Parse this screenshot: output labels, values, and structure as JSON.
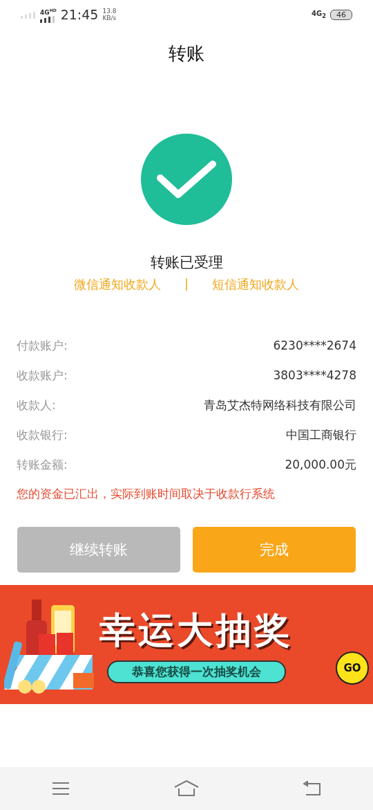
{
  "status_bar": {
    "network": "4G",
    "hd": "HD",
    "time": "21:45",
    "speed_value": "13.8",
    "speed_unit": "KB/s",
    "network_2": "4G",
    "sim": "2",
    "battery": "46"
  },
  "header": {
    "title": "转账"
  },
  "result": {
    "status": "转账已受理",
    "links": [
      "微信通知收款人",
      "短信通知收款人"
    ],
    "separator": "|"
  },
  "details": [
    {
      "label": "付款账户:",
      "value": "6230****2674"
    },
    {
      "label": "收款账户:",
      "value": "3803****4278"
    },
    {
      "label": "收款人:",
      "value": "青岛艾杰特网络科技有限公司"
    },
    {
      "label": "收款银行:",
      "value": "中国工商银行"
    },
    {
      "label": "转账金额:",
      "value": "20,000.00元"
    }
  ],
  "notice": "您的资金已汇出，实际到账时间取决于收款行系统",
  "buttons": [
    {
      "label": "继续转账",
      "disabled": true
    },
    {
      "label": "完成",
      "disabled": false
    }
  ],
  "banner": {
    "title": "幸运大抽奖",
    "subtitle": "恭喜您获得一次抽奖机会",
    "go": "GO"
  }
}
